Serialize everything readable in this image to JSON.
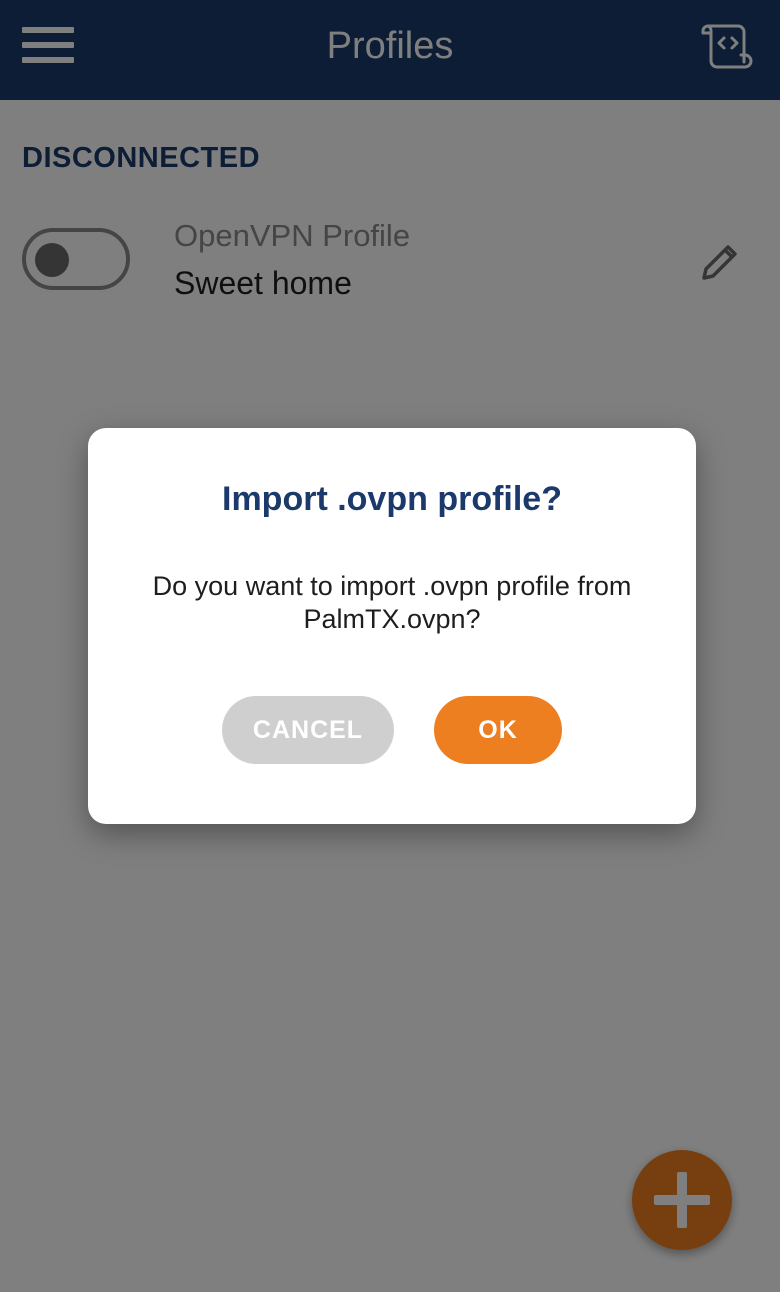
{
  "appbar": {
    "title": "Profiles",
    "menu_icon": "hamburger-menu-icon",
    "log_icon": "log-scroll-icon"
  },
  "section": {
    "title": "DISCONNECTED"
  },
  "profiles": [
    {
      "type": "OpenVPN Profile",
      "name": "Sweet home",
      "connected": false
    }
  ],
  "dialog": {
    "title": "Import .ovpn profile?",
    "message": "Do you want to import .ovpn profile from PalmTX.ovpn?",
    "cancel_label": "CANCEL",
    "ok_label": "OK"
  },
  "colors": {
    "primary": "#1b3a6b",
    "accent": "#ee7f21",
    "cancel": "#cfcfcf"
  }
}
